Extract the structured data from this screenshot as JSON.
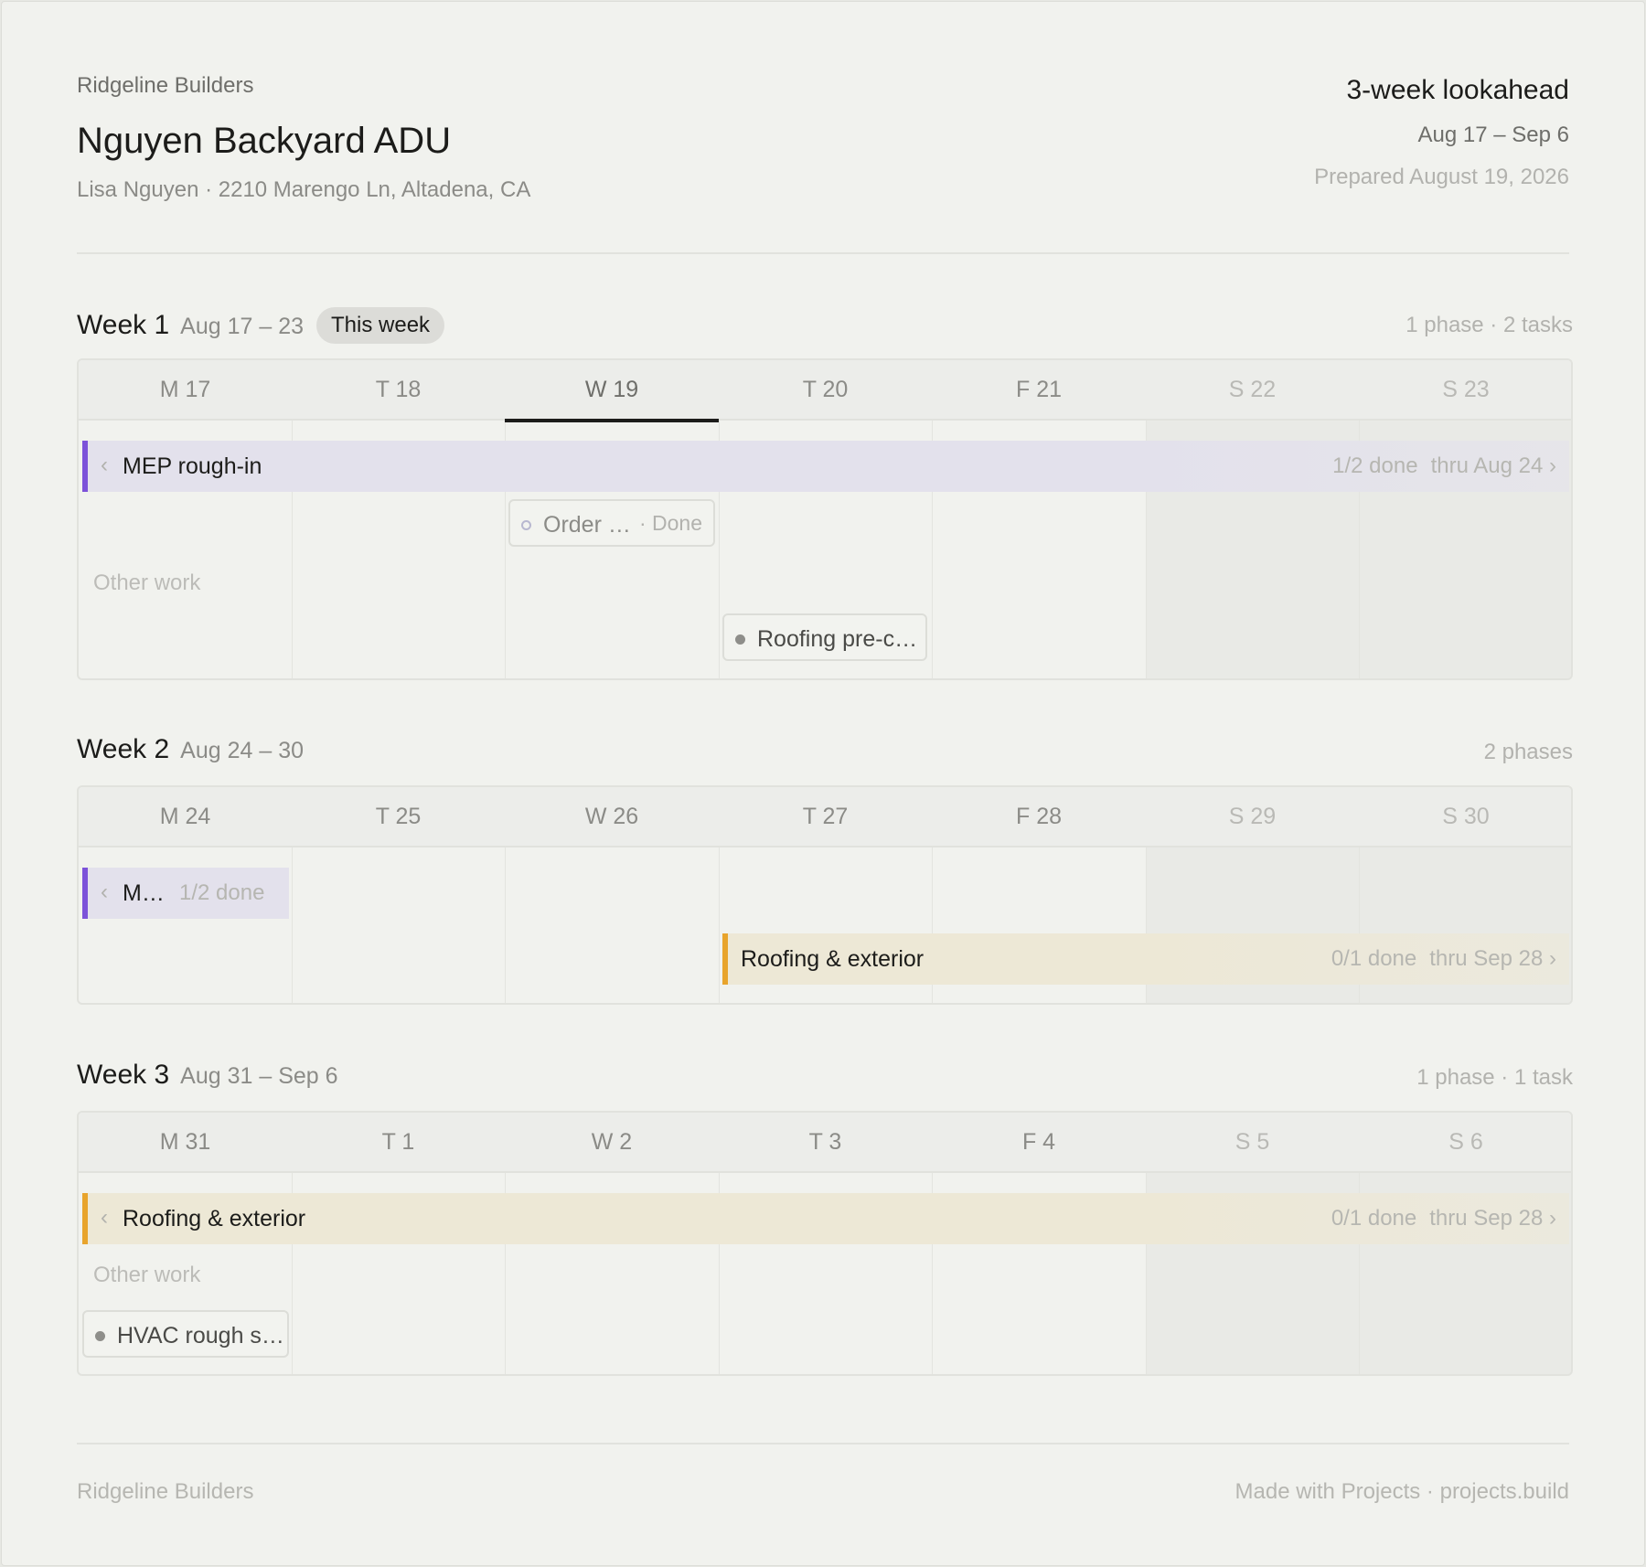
{
  "header": {
    "company": "Ridgeline Builders",
    "project_title": "Nguyen Backyard ADU",
    "client_line": "Lisa Nguyen · 2210 Marengo Ln, Altadena, CA",
    "lookahead_title": "3-week lookahead",
    "date_range": "Aug 17 – Sep 6",
    "prepared": "Prepared August 19, 2026"
  },
  "weeks": [
    {
      "title": "Week 1",
      "range": "Aug 17 – 23",
      "badge": "This week",
      "summary": "1 phase · 2 tasks",
      "days": [
        "M 17",
        "T 18",
        "W 19",
        "T 20",
        "F 21",
        "S 22",
        "S 23"
      ],
      "phase_bar": {
        "chevron": "‹",
        "label": "MEP rough-in",
        "progress": "1/2 done",
        "thru": "thru Aug 24 ›",
        "color": "#7c52d9"
      },
      "other_work_label": "Other work",
      "tasks": [
        {
          "label": "Order …",
          "status": "· Done"
        },
        {
          "label": "Roofing pre-c…"
        }
      ]
    },
    {
      "title": "Week 2",
      "range": "Aug 24 – 30",
      "summary": "2 phases",
      "days": [
        "M 24",
        "T 25",
        "W 26",
        "T 27",
        "F 28",
        "S 29",
        "S 30"
      ],
      "phase_bars": [
        {
          "chevron": "‹",
          "label": "M…",
          "progress": "1/2 done",
          "color": "#7c52d9"
        },
        {
          "label": "Roofing & exterior",
          "progress": "0/1 done",
          "thru": "thru Sep 28 ›",
          "color": "#e8a42c"
        }
      ]
    },
    {
      "title": "Week 3",
      "range": "Aug 31 – Sep 6",
      "summary": "1 phase · 1 task",
      "days": [
        "M 31",
        "T 1",
        "W 2",
        "T 3",
        "F 4",
        "S 5",
        "S 6"
      ],
      "phase_bar": {
        "chevron": "‹",
        "label": "Roofing & exterior",
        "progress": "0/1 done",
        "thru": "thru Sep 28 ›",
        "color": "#e8a42c"
      },
      "other_work_label": "Other work",
      "tasks": [
        {
          "label": "HVAC rough s…"
        }
      ]
    }
  ],
  "footer": {
    "left": "Ridgeline Builders",
    "right": "Made with Projects · projects.build"
  }
}
